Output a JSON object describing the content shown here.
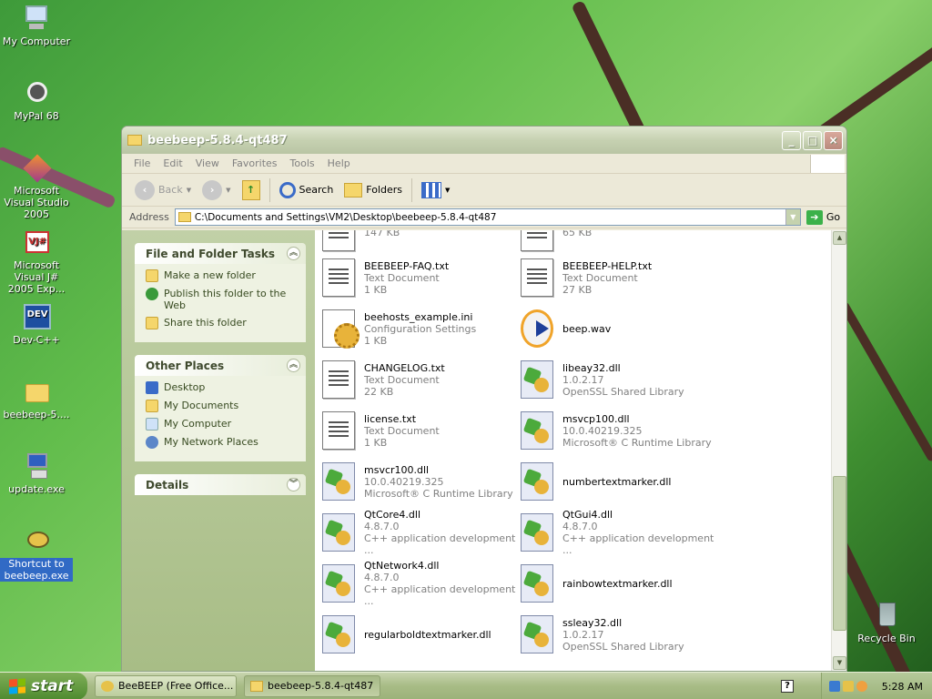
{
  "desktop": {
    "icons": [
      {
        "label": "My Computer"
      },
      {
        "label": "MyPal 68"
      },
      {
        "label": "Microsoft Visual Studio 2005"
      },
      {
        "label": "Microsoft Visual J# 2005 Exp..."
      },
      {
        "label": "Dev-C++"
      },
      {
        "label": "beebeep-5...."
      },
      {
        "label": "update.exe"
      },
      {
        "label": "Shortcut to beebeep.exe"
      },
      {
        "label": "Recycle Bin"
      }
    ]
  },
  "window": {
    "title": "beebeep-5.8.4-qt487",
    "menu": [
      "File",
      "Edit",
      "View",
      "Favorites",
      "Tools",
      "Help"
    ],
    "toolbar": {
      "back_label": "Back",
      "search_label": "Search",
      "folders_label": "Folders"
    },
    "address": {
      "label": "Address",
      "value": "C:\\Documents and Settings\\VM2\\Desktop\\beebeep-5.8.4-qt487",
      "go_label": "Go"
    },
    "taskpane": {
      "file_tasks": {
        "title": "File and Folder Tasks",
        "items": [
          "Make a new folder",
          "Publish this folder to the Web",
          "Share this folder"
        ]
      },
      "other_places": {
        "title": "Other Places",
        "items": [
          "Desktop",
          "My Documents",
          "My Computer",
          "My Network Places"
        ]
      },
      "details": {
        "title": "Details"
      }
    },
    "files": [
      {
        "name": "",
        "line2": "147 KB",
        "line3": "",
        "icon": "text"
      },
      {
        "name": "",
        "line2": "65 KB",
        "line3": "",
        "icon": "text"
      },
      {
        "name": "BEEBEEP-FAQ.txt",
        "line2": "Text Document",
        "line3": "1 KB",
        "icon": "text"
      },
      {
        "name": "BEEBEEP-HELP.txt",
        "line2": "Text Document",
        "line3": "27 KB",
        "icon": "text"
      },
      {
        "name": "beehosts_example.ini",
        "line2": "Configuration Settings",
        "line3": "1 KB",
        "icon": "ini"
      },
      {
        "name": "beep.wav",
        "line2": "",
        "line3": "",
        "icon": "wav"
      },
      {
        "name": "CHANGELOG.txt",
        "line2": "Text Document",
        "line3": "22 KB",
        "icon": "text"
      },
      {
        "name": "libeay32.dll",
        "line2": "1.0.2.17",
        "line3": "OpenSSL Shared Library",
        "icon": "dll"
      },
      {
        "name": "license.txt",
        "line2": "Text Document",
        "line3": "1 KB",
        "icon": "text"
      },
      {
        "name": "msvcp100.dll",
        "line2": "10.0.40219.325",
        "line3": "Microsoft® C Runtime Library",
        "icon": "dll"
      },
      {
        "name": "msvcr100.dll",
        "line2": "10.0.40219.325",
        "line3": "Microsoft® C Runtime Library",
        "icon": "dll"
      },
      {
        "name": "numbertextmarker.dll",
        "line2": "",
        "line3": "",
        "icon": "dll"
      },
      {
        "name": "QtCore4.dll",
        "line2": "4.8.7.0",
        "line3": "C++ application development ...",
        "icon": "dll"
      },
      {
        "name": "QtGui4.dll",
        "line2": "4.8.7.0",
        "line3": "C++ application development ...",
        "icon": "dll"
      },
      {
        "name": "QtNetwork4.dll",
        "line2": "4.8.7.0",
        "line3": "C++ application development ...",
        "icon": "dll"
      },
      {
        "name": "rainbowtextmarker.dll",
        "line2": "",
        "line3": "",
        "icon": "dll"
      },
      {
        "name": "regularboldtextmarker.dll",
        "line2": "",
        "line3": "",
        "icon": "dll"
      },
      {
        "name": "ssleay32.dll",
        "line2": "1.0.2.17",
        "line3": "OpenSSL Shared Library",
        "icon": "dll"
      }
    ]
  },
  "taskbar": {
    "start_label": "start",
    "items": [
      {
        "label": "BeeBEEP (Free Office..."
      },
      {
        "label": "beebeep-5.8.4-qt487"
      }
    ],
    "clock": "5:28 AM"
  }
}
